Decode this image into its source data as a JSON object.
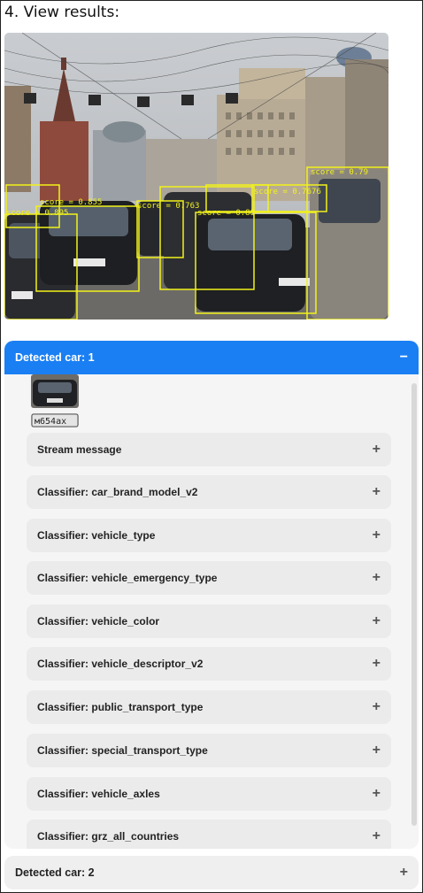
{
  "heading": "4. View results:",
  "detections": [
    {
      "label": "score = 0.855"
    },
    {
      "label": "score = 0.895"
    },
    {
      "label": "score = 0.763"
    },
    {
      "label": "score = 0.88"
    },
    {
      "label": "score = 0.7676"
    },
    {
      "label": "score = 0.79"
    }
  ],
  "open_panel": {
    "title": "Detected car: 1",
    "toggle_icon": "−",
    "plate_text": "м654ах",
    "sections": [
      {
        "label": "Stream message",
        "icon": "+"
      },
      {
        "label": "Classifier: car_brand_model_v2",
        "icon": "+"
      },
      {
        "label": "Classifier: vehicle_type",
        "icon": "+"
      },
      {
        "label": "Classifier: vehicle_emergency_type",
        "icon": "+"
      },
      {
        "label": "Classifier: vehicle_color",
        "icon": "+"
      },
      {
        "label": "Classifier: vehicle_descriptor_v2",
        "icon": "+"
      },
      {
        "label": "Classifier: public_transport_type",
        "icon": "+"
      },
      {
        "label": "Classifier: special_transport_type",
        "icon": "+"
      },
      {
        "label": "Classifier: vehicle_axles",
        "icon": "+"
      },
      {
        "label": "Classifier: grz_all_countries",
        "icon": "+"
      }
    ]
  },
  "closed_panel": {
    "title": "Detected car: 2",
    "toggle_icon": "+"
  },
  "colors": {
    "accent": "#1a7ff3",
    "bbox": "#f2f21a"
  }
}
